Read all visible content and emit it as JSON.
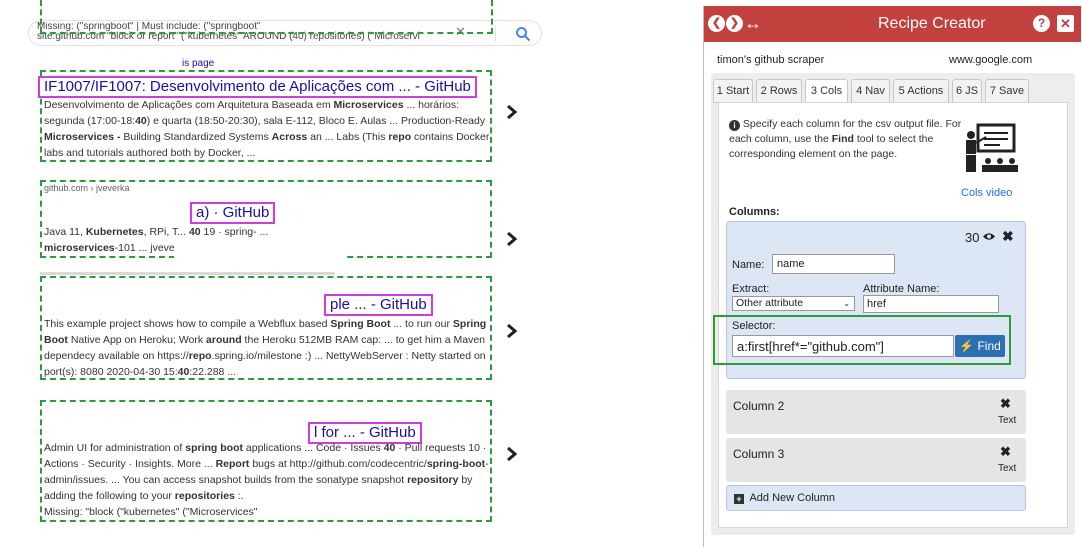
{
  "search": {
    "query_line1": "Missing: (\"springboot\" | Must include: (\"springboot\"",
    "query_line2": "site:github.com \"block or report\" (\"kubernetes\" AROUND (40) repositories) (\"Microservi"
  },
  "results": [
    {
      "sublink": "is page",
      "title": "IF1007/IF1007: Desenvolvimento de Aplicações com ... - GitHub",
      "snippet_html": "Desenvolvimento de Aplicações com Arquitetura Baseada em <b>Microservices</b> ... horários: segunda (17:00-18:<b>40</b>) e quarta (18:50-20:30), sala E-112, Bloco E. Aulas ... Production-Ready <b>Microservices -</b> Building Standardized Systems <b>Across</b> an ... Labs (This <b>repo</b> contains Docker labs and tutorials authored both by Docker, ..."
    },
    {
      "url": "github.com › jveverka",
      "title": "a) · GitHub",
      "snippet_html": "Java 11, <b>Kubernetes</b>, RPi, T... <b>40</b> 19 · spring- ...<br><b>microservices</b>-101 ... jveve ... <b>positories</b>."
    },
    {
      "title": "ple ... - GitHub",
      "snippet_html": "This example project shows how to compile a Webflux based <b>Spring Boot</b> ... to run our <b>Spring Boot</b> Native App on Heroku; Work <b>around</b> the Heroku 512MB RAM cap: ... to get him a Maven dependecy available on https://<b>repo</b>.spring.io/milestone :) ... NettyWebServer : Netty started on port(s): 8080 2020-04-30 15:<b>40</b>:22.288 ..."
    },
    {
      "title": "l for ... - GitHub",
      "snippet_html": "Admin UI for administration of <b>spring boot</b> applications ... Code · Issues <b>40</b> · Pull requests 10 · Actions · Security · Insights. More ... <b>Report</b> bugs at http://github.com/codecentric/<b>spring-boot</b>-admin/issues. ... You can access snapshot builds from the sonatype snapshot <b>repository</b> by adding the following to your <b>repositories</b> :.<br>Missing: \"block (\"kubernetes\" (\"Microservices\""
    }
  ],
  "panel": {
    "title": "Recipe Creator",
    "expand_glyph": "↔",
    "recipe_name": "timon's github scraper",
    "recipe_site": "www.google.com",
    "tabs": [
      "1 Start",
      "2 Rows",
      "3 Cols",
      "4 Nav",
      "5 Actions",
      "6 JS",
      "7 Save"
    ],
    "active_tab": "3 Cols",
    "info_html": "Specify each column for the csv output file. For each column, use the <b>Find</b> tool to select the corresponding element on the page.",
    "cols_video": "Cols video",
    "columns_label": "Columns:",
    "column1": {
      "count": "30",
      "name_label": "Name:",
      "name_value": "name",
      "extract_label": "Extract:",
      "extract_value": "Other attribute",
      "attr_label": "Attribute Name:",
      "attr_value": "href",
      "selector_label": "Selector:",
      "selector_value": "a:first[href*=\"github.com\"]",
      "find_label": "Find"
    },
    "columns": [
      {
        "label": "Column 2",
        "type": "Text"
      },
      {
        "label": "Column 3",
        "type": "Text"
      }
    ],
    "add_column": "Add New Column"
  },
  "colors": {
    "header": "#c2403e",
    "highlight_green": "#2a9d3a",
    "highlight_magenta": "#d23be0",
    "link": "#1a0dab",
    "find_button": "#2d6fb3"
  }
}
